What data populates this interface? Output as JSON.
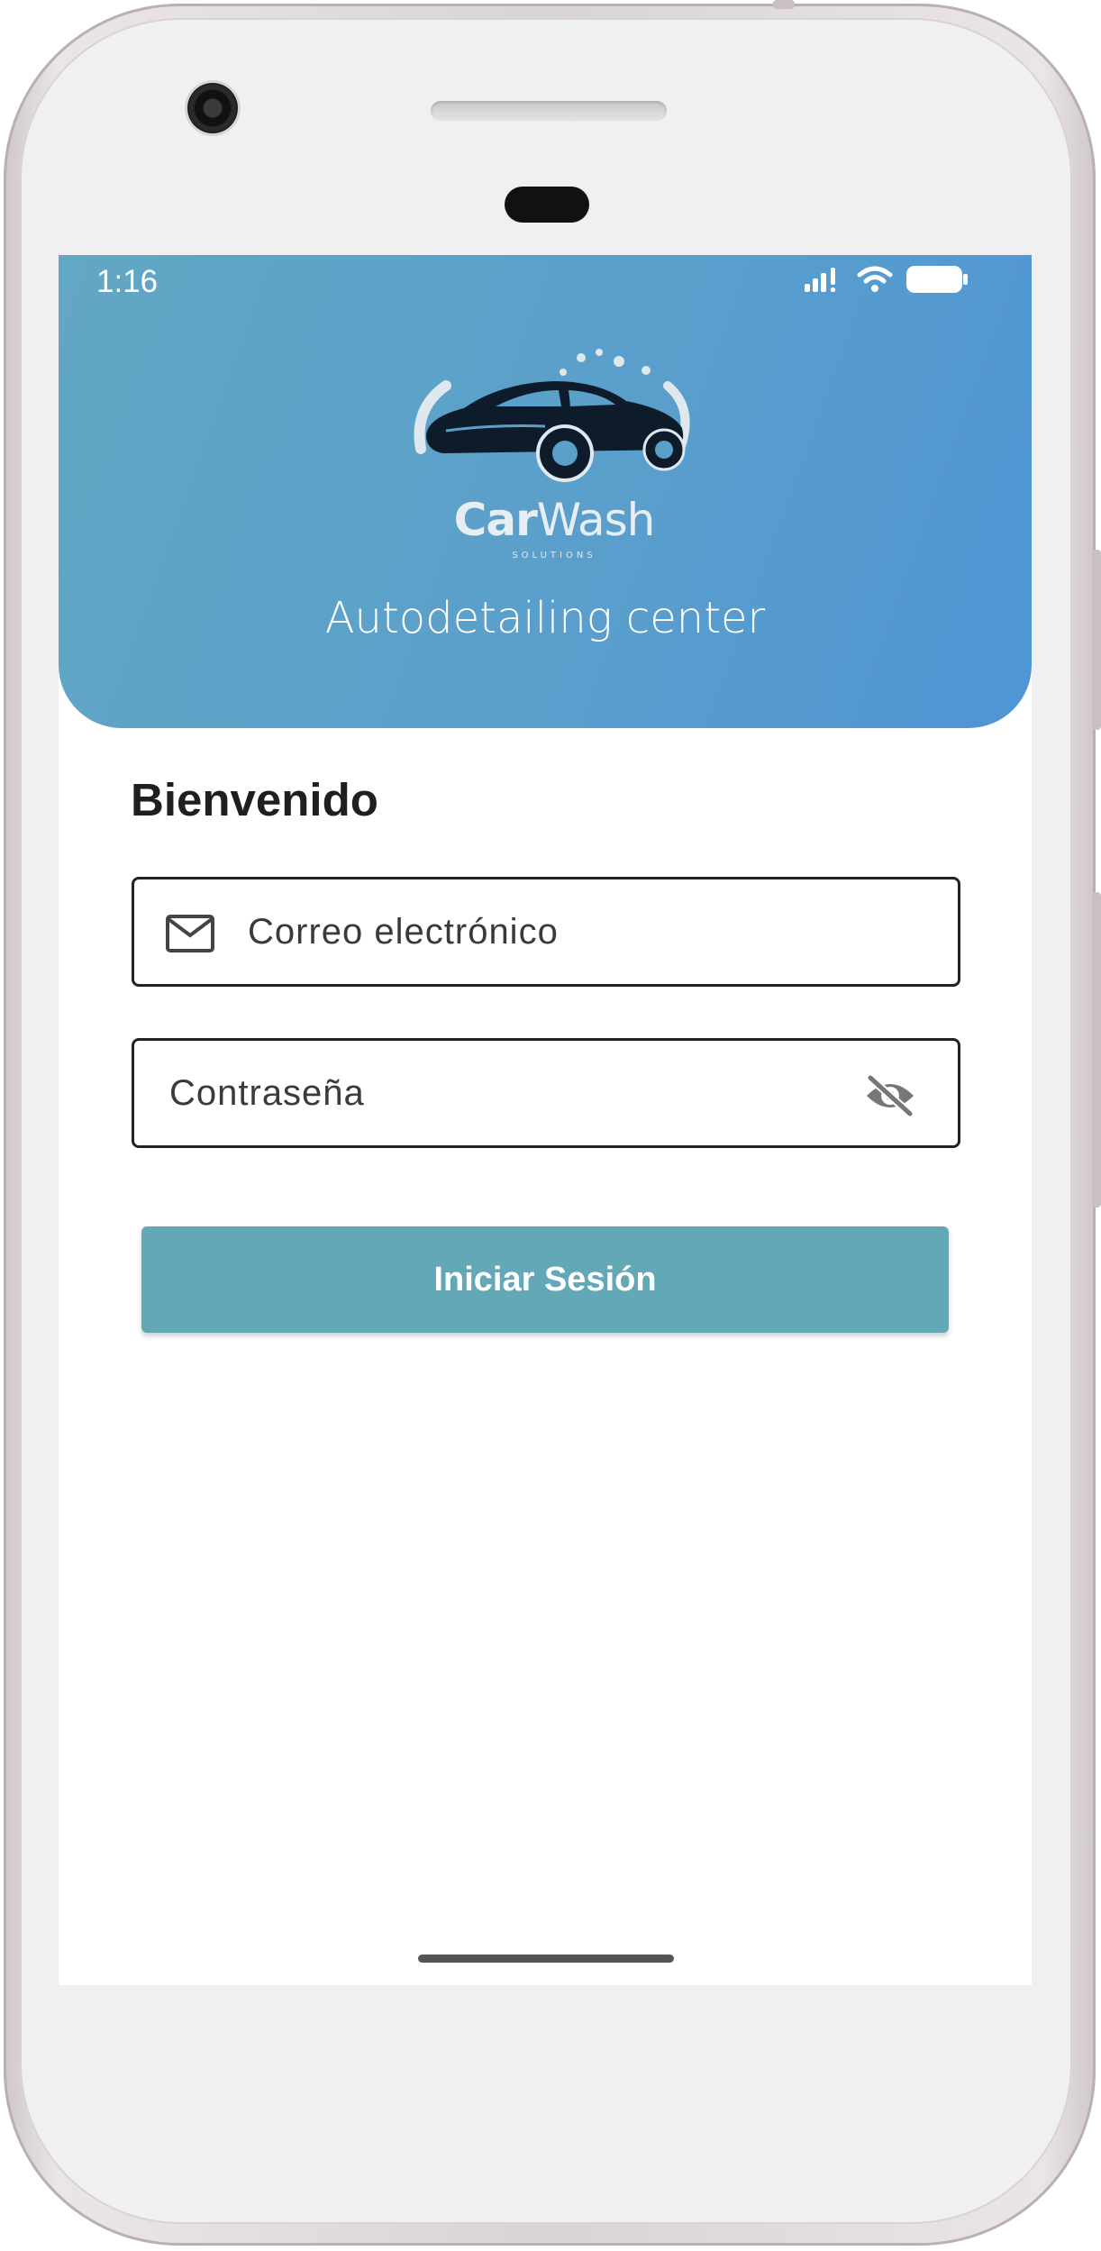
{
  "status_bar": {
    "time": "1:16"
  },
  "header": {
    "logo": {
      "brand_car": "Car",
      "brand_wash": "Wash",
      "brand_sub": "SOLUTIONS"
    },
    "tagline": "Autodetailing center"
  },
  "form": {
    "welcome": "Bienvenido",
    "email": {
      "placeholder": "Correo electrónico",
      "icon": "mail-icon"
    },
    "password": {
      "placeholder": "Contraseña",
      "icon": "eye-off-icon"
    },
    "submit_label": "Iniciar Sesión"
  },
  "colors": {
    "header_start": "#62a7c3",
    "header_end": "#4f95d5",
    "button": "#63a8b7",
    "text_dark": "#1f1f1f"
  }
}
